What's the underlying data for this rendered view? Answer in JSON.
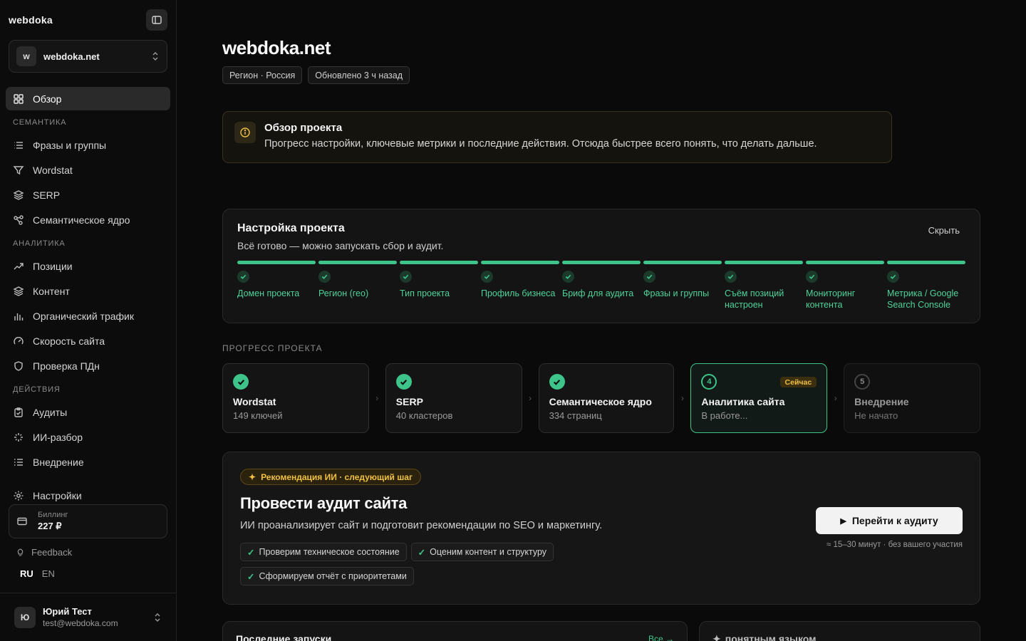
{
  "brand": "webdoka",
  "project": {
    "avatar": "w",
    "name": "webdoka.net"
  },
  "nav": {
    "overview": "Обзор",
    "sections": {
      "semantics": "СЕМАНТИКА",
      "analytics": "АНАЛИТИКА",
      "actions": "ДЕЙСТВИЯ"
    },
    "semantics_items": [
      "Фразы и группы",
      "Wordstat",
      "SERP",
      "Семантическое ядро"
    ],
    "analytics_items": [
      "Позиции",
      "Контент",
      "Органический трафик",
      "Скорость сайта",
      "Проверка ПДн"
    ],
    "actions_items": [
      "Аудиты",
      "ИИ-разбор",
      "Внедрение"
    ],
    "settings": "Настройки"
  },
  "billing": {
    "label": "Биллинг",
    "value": "227 ₽"
  },
  "feedback": "Feedback",
  "langs": {
    "ru": "RU",
    "en": "EN"
  },
  "user": {
    "avatar": "Ю",
    "name": "Юрий Тест",
    "email": "test@webdoka.com"
  },
  "page": {
    "title": "webdoka.net",
    "chips": [
      "Регион · Россия",
      "Обновлено 3 ч назад"
    ]
  },
  "notice": {
    "title": "Обзор проекта",
    "text": "Прогресс настройки, ключевые метрики и последние действия. Отсюда быстрее всего понять, что делать дальше."
  },
  "setup": {
    "title": "Настройка проекта",
    "subtitle": "Всё готово — можно запускать сбор и аудит.",
    "hide": "Скрыть",
    "steps": [
      "Домен проекта",
      "Регион (гео)",
      "Тип проекта",
      "Профиль бизнеса",
      "Бриф для аудита",
      "Фразы и группы",
      "Съём позиций настроен",
      "Мониторинг контента",
      "Метрика / Google Search Console"
    ]
  },
  "progress": {
    "label": "ПРОГРЕСС ПРОЕКТА",
    "stages": [
      {
        "title": "Wordstat",
        "sub": "149 ключей",
        "state": "done"
      },
      {
        "title": "SERP",
        "sub": "40 кластеров",
        "state": "done"
      },
      {
        "title": "Семантическое ядро",
        "sub": "334 страниц",
        "state": "done"
      },
      {
        "num": "4",
        "title": "Аналитика сайта",
        "sub": "В работе...",
        "state": "current",
        "badge": "Сейчас"
      },
      {
        "num": "5",
        "title": "Внедрение",
        "sub": "Не начато",
        "state": "pending"
      }
    ]
  },
  "reco": {
    "tag": "Рекомендация ИИ · следующий шаг",
    "title": "Провести аудит сайта",
    "text": "ИИ проанализирует сайт и подготовит рекомендации по SEO и маркетингу.",
    "points": [
      "Проверим техническое состояние",
      "Оценим контент и структуру",
      "Сформируем отчёт с приоритетами"
    ],
    "button": "Перейти к аудиту",
    "note": "≈ 15–30 минут · без вашего участия"
  },
  "bottom": {
    "runs_title": "Последние запуски",
    "runs_link": "Все →",
    "plain_title": "понятным языком"
  },
  "colors": {
    "accent": "#3ec48a",
    "warning": "#f0c040"
  }
}
